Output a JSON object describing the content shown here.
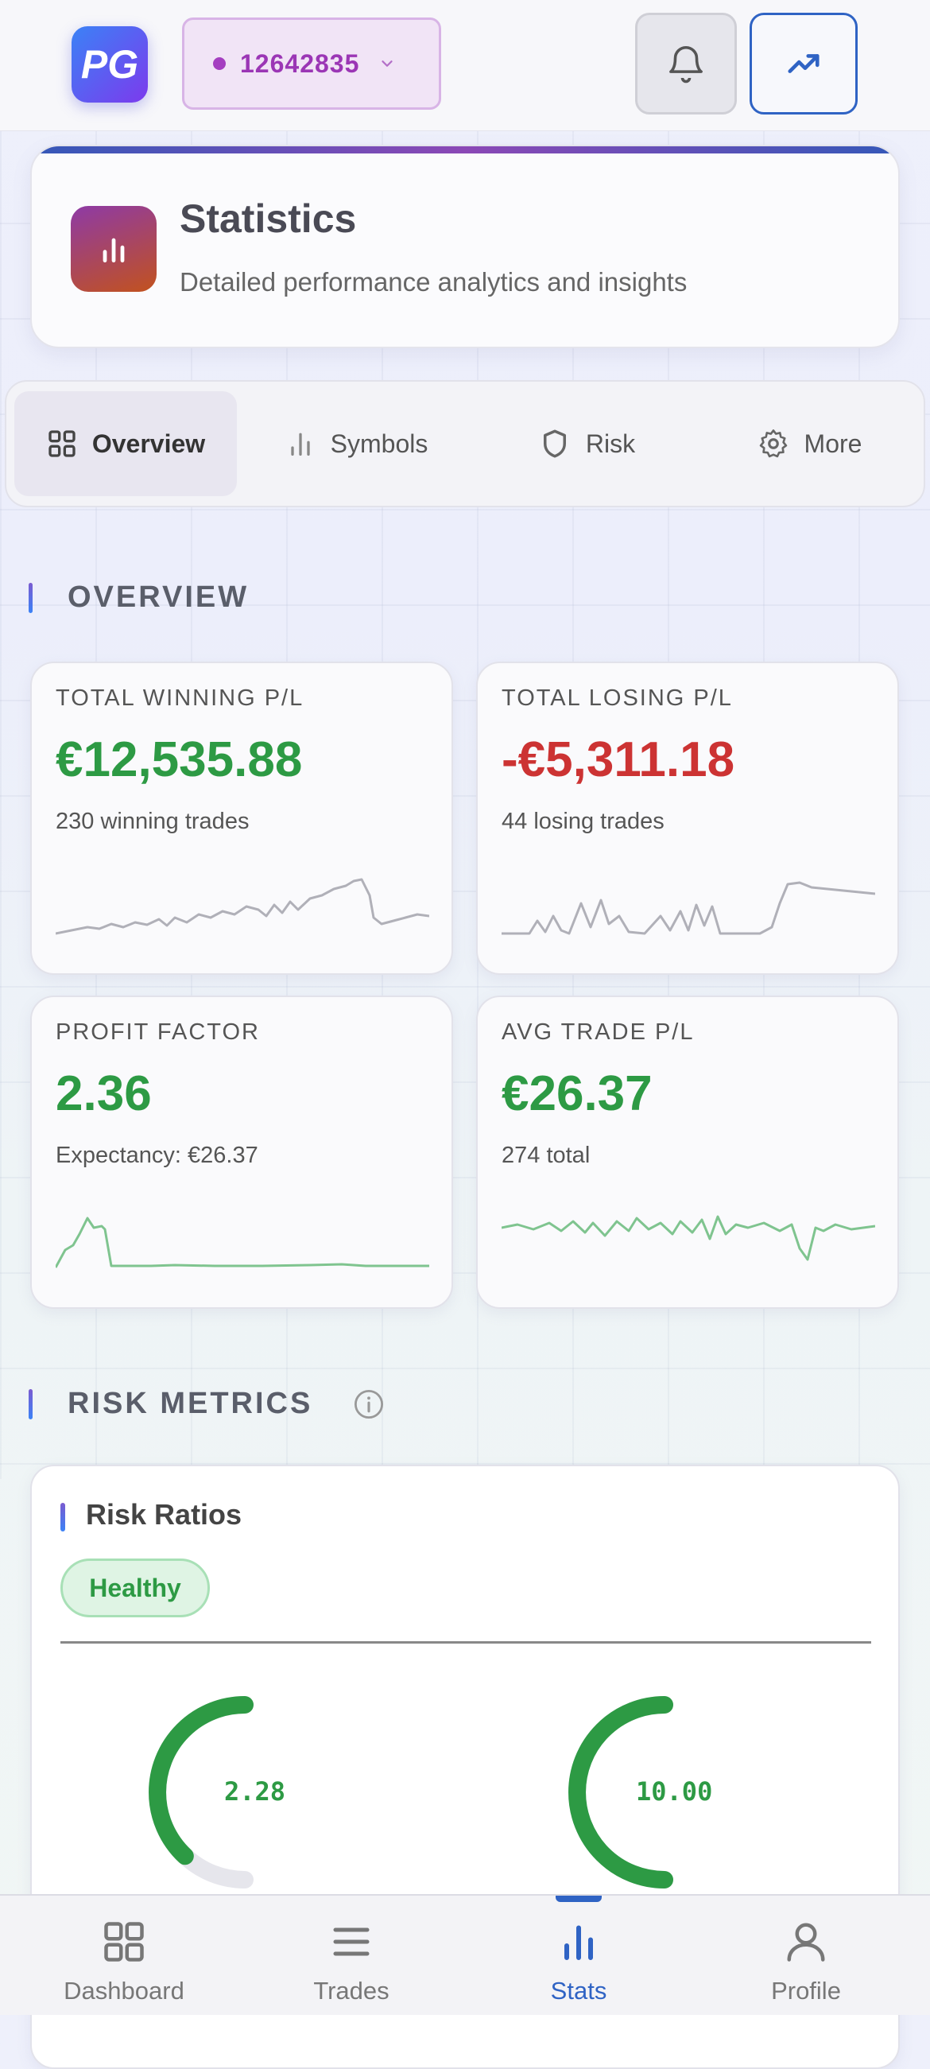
{
  "header": {
    "logo_text": "PG",
    "account_number": "12642835",
    "icons": [
      "bell-icon",
      "trending-up-icon",
      "chevron-down-icon"
    ],
    "accent": "#9b36b5"
  },
  "page": {
    "title": "Statistics",
    "subtitle": "Detailed performance analytics and insights"
  },
  "tabs": [
    {
      "label": "Overview",
      "icon": "grid-icon",
      "active": true
    },
    {
      "label": "Symbols",
      "icon": "bar-chart-icon",
      "active": false
    },
    {
      "label": "Risk",
      "icon": "shield-icon",
      "active": false
    },
    {
      "label": "More",
      "icon": "gear-icon",
      "active": false
    }
  ],
  "overview": {
    "heading": "OVERVIEW",
    "cards": [
      {
        "label": "TOTAL WINNING P/L",
        "value": "€12,535.88",
        "sub": "230 winning trades",
        "tone": "green",
        "spark_color": "#b0b0b8"
      },
      {
        "label": "TOTAL LOSING P/L",
        "value": "-€5,311.18",
        "sub": "44 losing trades",
        "tone": "red",
        "spark_color": "#b0b0b8"
      },
      {
        "label": "PROFIT FACTOR",
        "value": "2.36",
        "sub": "Expectancy: €26.37",
        "tone": "green",
        "spark_color": "#7fc48f"
      },
      {
        "label": "AVG TRADE P/L",
        "value": "€26.37",
        "sub": "274 total",
        "tone": "green",
        "spark_color": "#7fc48f"
      }
    ]
  },
  "risk": {
    "heading": "RISK METRICS",
    "card_title": "Risk Ratios",
    "status_badge": "Healthy",
    "gauges": [
      {
        "value_text": "2.28",
        "fill": 0.76
      },
      {
        "value_text": "10.00",
        "fill": 1.0
      }
    ],
    "status_color": "#2d9a44"
  },
  "nav": [
    {
      "label": "Dashboard",
      "icon": "grid-icon",
      "active": false
    },
    {
      "label": "Trades",
      "icon": "list-icon",
      "active": false
    },
    {
      "label": "Stats",
      "icon": "bar-chart-icon",
      "active": true
    },
    {
      "label": "Profile",
      "icon": "user-icon",
      "active": false
    }
  ]
}
